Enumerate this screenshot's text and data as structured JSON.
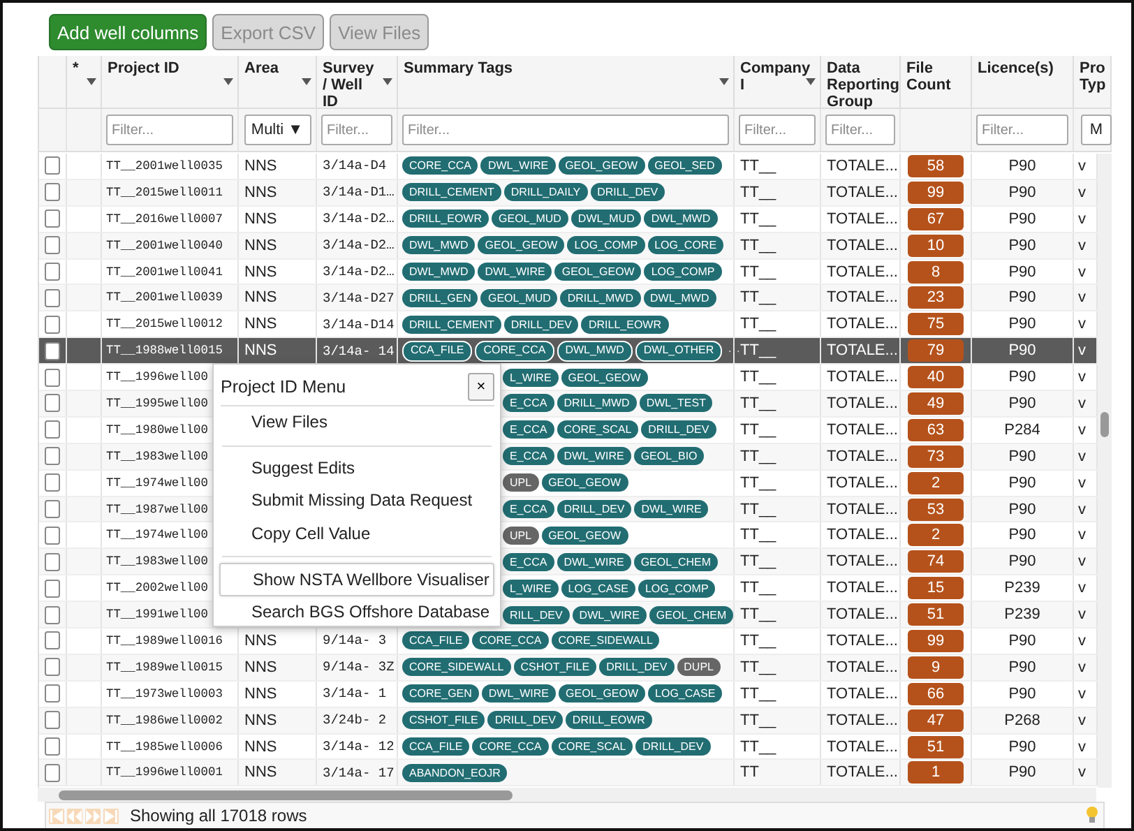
{
  "toolbar": {
    "buttons": [
      {
        "label": "Add well columns",
        "disabled": false
      },
      {
        "label": "Export CSV",
        "disabled": true
      },
      {
        "label": "View Files",
        "disabled": true
      }
    ]
  },
  "table": {
    "columns": [
      {
        "label": "*",
        "has_menu": true
      },
      {
        "label": "Project ID",
        "has_menu": true,
        "filter": {
          "kind": "text",
          "placeholder": "Filter..."
        }
      },
      {
        "label": "Area",
        "has_menu": true,
        "filter": {
          "kind": "select",
          "value": "Multi ▼"
        }
      },
      {
        "label": "Survey / Well ID",
        "has_menu": true,
        "filter": {
          "kind": "text",
          "placeholder": "Filter..."
        }
      },
      {
        "label": "Summary Tags",
        "has_menu": true,
        "filter": {
          "kind": "text",
          "placeholder": "Filter..."
        }
      },
      {
        "label": "Company I",
        "has_menu": true,
        "filter": {
          "kind": "text",
          "placeholder": "Filter..."
        }
      },
      {
        "label": "Data Reporting Group",
        "has_menu": false,
        "filter": {
          "kind": "text",
          "placeholder": "Filter..."
        }
      },
      {
        "label": "File Count",
        "has_menu": false
      },
      {
        "label": "Licence(s)",
        "has_menu": false,
        "filter": {
          "kind": "text",
          "placeholder": "Filter..."
        }
      },
      {
        "label": "Pro Typ",
        "has_menu": false,
        "filter": {
          "kind": "select",
          "value": "M"
        }
      }
    ],
    "rows": [
      {
        "checked": false,
        "selected": false,
        "covered": false,
        "project_id": "TT__2001well0035",
        "area": "NNS",
        "survey": "3/14a-D4",
        "tags": [
          {
            "label": "CORE_CCA",
            "kind": "tag"
          },
          {
            "label": "DWL_WIRE",
            "kind": "tag"
          },
          {
            "label": "GEOL_GEOW",
            "kind": "tag"
          },
          {
            "label": "GEOL_SED",
            "kind": "tag"
          }
        ],
        "company": "TT__",
        "group": "TOTALE...",
        "file_count": "58",
        "licence": "P90",
        "type": "v"
      },
      {
        "checked": false,
        "selected": false,
        "covered": false,
        "project_id": "TT__2015well0011",
        "area": "NNS",
        "survey": "3/14a-D1…",
        "tags": [
          {
            "label": "DRILL_CEMENT",
            "kind": "tag"
          },
          {
            "label": "DRILL_DAILY",
            "kind": "tag"
          },
          {
            "label": "DRILL_DEV",
            "kind": "tag"
          }
        ],
        "company": "TT__",
        "group": "TOTALE...",
        "file_count": "99",
        "licence": "P90",
        "type": "v"
      },
      {
        "checked": false,
        "selected": false,
        "covered": false,
        "project_id": "TT__2016well0007",
        "area": "NNS",
        "survey": "3/14a-D2…",
        "tags": [
          {
            "label": "DRILL_EOWR",
            "kind": "tag"
          },
          {
            "label": "GEOL_MUD",
            "kind": "tag"
          },
          {
            "label": "DWL_MUD",
            "kind": "tag"
          },
          {
            "label": "DWL_MWD",
            "kind": "tag"
          }
        ],
        "company": "TT__",
        "group": "TOTALE...",
        "file_count": "67",
        "licence": "P90",
        "type": "v"
      },
      {
        "checked": false,
        "selected": false,
        "covered": false,
        "project_id": "TT__2001well0040",
        "area": "NNS",
        "survey": "3/14a-D2…",
        "tags": [
          {
            "label": "DWL_MWD",
            "kind": "tag"
          },
          {
            "label": "GEOL_GEOW",
            "kind": "tag"
          },
          {
            "label": "LOG_COMP",
            "kind": "tag"
          },
          {
            "label": "LOG_CORE",
            "kind": "tag"
          }
        ],
        "company": "TT__",
        "group": "TOTALE...",
        "file_count": "10",
        "licence": "P90",
        "type": "v"
      },
      {
        "checked": false,
        "selected": false,
        "covered": false,
        "project_id": "TT__2001well0041",
        "area": "NNS",
        "survey": "3/14a-D2…",
        "tags": [
          {
            "label": "DWL_MWD",
            "kind": "tag"
          },
          {
            "label": "DWL_WIRE",
            "kind": "tag"
          },
          {
            "label": "GEOL_GEOW",
            "kind": "tag"
          },
          {
            "label": "LOG_COMP",
            "kind": "tag"
          }
        ],
        "company": "TT__",
        "group": "TOTALE...",
        "file_count": "8",
        "licence": "P90",
        "type": "v"
      },
      {
        "checked": false,
        "selected": false,
        "covered": false,
        "project_id": "TT__2001well0039",
        "area": "NNS",
        "survey": "3/14a-D27",
        "tags": [
          {
            "label": "DRILL_GEN",
            "kind": "tag"
          },
          {
            "label": "GEOL_MUD",
            "kind": "tag"
          },
          {
            "label": "DRILL_MWD",
            "kind": "tag"
          },
          {
            "label": "DWL_MWD",
            "kind": "tag"
          }
        ],
        "company": "TT__",
        "group": "TOTALE...",
        "file_count": "23",
        "licence": "P90",
        "type": "v"
      },
      {
        "checked": false,
        "selected": false,
        "covered": false,
        "project_id": "TT__2015well0012",
        "area": "NNS",
        "survey": "3/14a-D14",
        "tags": [
          {
            "label": "DRILL_CEMENT",
            "kind": "tag"
          },
          {
            "label": "DRILL_DEV",
            "kind": "tag"
          },
          {
            "label": "DRILL_EOWR",
            "kind": "tag"
          }
        ],
        "company": "TT__",
        "group": "TOTALE...",
        "file_count": "75",
        "licence": "P90",
        "type": "v"
      },
      {
        "checked": false,
        "selected": true,
        "covered": false,
        "project_id": "TT__1988well0015",
        "area": "NNS",
        "survey": "3/14a- 14",
        "tags": [
          {
            "label": "CCA_FILE",
            "kind": "tag"
          },
          {
            "label": "CORE_CCA",
            "kind": "tag"
          },
          {
            "label": "DWL_MWD",
            "kind": "tag"
          },
          {
            "label": "DWL_OTHER",
            "kind": "tag"
          }
        ],
        "more": "···",
        "company": "TT__",
        "group": "TOTALE...",
        "file_count": "79",
        "licence": "P90",
        "type": "v"
      },
      {
        "checked": false,
        "selected": false,
        "covered": true,
        "project_id": "TT__1996well00",
        "tags": [
          {
            "label": "L_WIRE",
            "kind": "tag"
          },
          {
            "label": "GEOL_GEOW",
            "kind": "tag"
          }
        ],
        "company": "TT__",
        "group": "TOTALE...",
        "file_count": "40",
        "licence": "P90",
        "type": "v"
      },
      {
        "checked": false,
        "selected": false,
        "covered": true,
        "project_id": "TT__1995well00",
        "tags": [
          {
            "label": "E_CCA",
            "kind": "tag"
          },
          {
            "label": "DRILL_MWD",
            "kind": "tag"
          },
          {
            "label": "DWL_TEST",
            "kind": "tag"
          }
        ],
        "company": "TT__",
        "group": "TOTALE...",
        "file_count": "49",
        "licence": "P90",
        "type": "v"
      },
      {
        "checked": false,
        "selected": false,
        "covered": true,
        "project_id": "TT__1980well00",
        "tags": [
          {
            "label": "E_CCA",
            "kind": "tag"
          },
          {
            "label": "CORE_SCAL",
            "kind": "tag"
          },
          {
            "label": "DRILL_DEV",
            "kind": "tag"
          }
        ],
        "company": "TT__",
        "group": "TOTALE...",
        "file_count": "63",
        "licence": "P284",
        "type": "v"
      },
      {
        "checked": false,
        "selected": false,
        "covered": true,
        "project_id": "TT__1983well00",
        "tags": [
          {
            "label": "E_CCA",
            "kind": "tag"
          },
          {
            "label": "DWL_WIRE",
            "kind": "tag"
          },
          {
            "label": "GEOL_BIO",
            "kind": "tag"
          }
        ],
        "company": "TT__",
        "group": "TOTALE...",
        "file_count": "73",
        "licence": "P90",
        "type": "v"
      },
      {
        "checked": false,
        "selected": false,
        "covered": true,
        "project_id": "TT__1974well00",
        "tags": [
          {
            "label": "UPL",
            "kind": "flag"
          },
          {
            "label": "GEOL_GEOW",
            "kind": "tag"
          }
        ],
        "company": "TT__",
        "group": "TOTALE...",
        "file_count": "2",
        "licence": "P90",
        "type": "v"
      },
      {
        "checked": false,
        "selected": false,
        "covered": true,
        "project_id": "TT__1987well00",
        "tags": [
          {
            "label": "E_CCA",
            "kind": "tag"
          },
          {
            "label": "DRILL_DEV",
            "kind": "tag"
          },
          {
            "label": "DWL_WIRE",
            "kind": "tag"
          }
        ],
        "company": "TT__",
        "group": "TOTALE...",
        "file_count": "53",
        "licence": "P90",
        "type": "v"
      },
      {
        "checked": false,
        "selected": false,
        "covered": true,
        "project_id": "TT__1974well00",
        "tags": [
          {
            "label": "UPL",
            "kind": "flag"
          },
          {
            "label": "GEOL_GEOW",
            "kind": "tag"
          }
        ],
        "company": "TT__",
        "group": "TOTALE...",
        "file_count": "2",
        "licence": "P90",
        "type": "v"
      },
      {
        "checked": false,
        "selected": false,
        "covered": true,
        "project_id": "TT__1983well00",
        "tags": [
          {
            "label": "E_CCA",
            "kind": "tag"
          },
          {
            "label": "DWL_WIRE",
            "kind": "tag"
          },
          {
            "label": "GEOL_CHEM",
            "kind": "tag"
          }
        ],
        "company": "TT__",
        "group": "TOTALE...",
        "file_count": "74",
        "licence": "P90",
        "type": "v"
      },
      {
        "checked": false,
        "selected": false,
        "covered": true,
        "project_id": "TT__2002well00",
        "tags": [
          {
            "label": "L_WIRE",
            "kind": "tag"
          },
          {
            "label": "LOG_CASE",
            "kind": "tag"
          },
          {
            "label": "LOG_COMP",
            "kind": "tag"
          }
        ],
        "company": "TT__",
        "group": "TOTALE...",
        "file_count": "15",
        "licence": "P239",
        "type": "v"
      },
      {
        "checked": false,
        "selected": false,
        "covered": true,
        "project_id": "TT__1991well00",
        "tags": [
          {
            "label": "RILL_DEV",
            "kind": "tag"
          },
          {
            "label": "DWL_WIRE",
            "kind": "tag"
          },
          {
            "label": "GEOL_CHEM",
            "kind": "tag"
          }
        ],
        "company": "TT__",
        "group": "TOTALE...",
        "file_count": "51",
        "licence": "P239",
        "type": "v"
      },
      {
        "checked": false,
        "selected": false,
        "covered": false,
        "project_id": "TT__1989well0016",
        "area": "NNS",
        "survey": "9/14a- 3",
        "tags": [
          {
            "label": "CCA_FILE",
            "kind": "tag"
          },
          {
            "label": "CORE_CCA",
            "kind": "tag"
          },
          {
            "label": "CORE_SIDEWALL",
            "kind": "tag"
          }
        ],
        "company": "TT__",
        "group": "TOTALE...",
        "file_count": "99",
        "licence": "P90",
        "type": "v"
      },
      {
        "checked": false,
        "selected": false,
        "covered": false,
        "project_id": "TT__1989well0015",
        "area": "NNS",
        "survey": "9/14a- 3Z",
        "tags": [
          {
            "label": "CORE_SIDEWALL",
            "kind": "tag"
          },
          {
            "label": "CSHOT_FILE",
            "kind": "tag"
          },
          {
            "label": "DRILL_DEV",
            "kind": "tag"
          },
          {
            "label": "DUPL",
            "kind": "flag"
          }
        ],
        "company": "TT__",
        "group": "TOTALE...",
        "file_count": "9",
        "licence": "P90",
        "type": "v"
      },
      {
        "checked": false,
        "selected": false,
        "covered": false,
        "project_id": "TT__1973well0003",
        "area": "NNS",
        "survey": "3/14a- 1",
        "tags": [
          {
            "label": "CORE_GEN",
            "kind": "tag"
          },
          {
            "label": "DWL_WIRE",
            "kind": "tag"
          },
          {
            "label": "GEOL_GEOW",
            "kind": "tag"
          },
          {
            "label": "LOG_CASE",
            "kind": "tag"
          }
        ],
        "company": "TT__",
        "group": "TOTALE...",
        "file_count": "66",
        "licence": "P90",
        "type": "v"
      },
      {
        "checked": false,
        "selected": false,
        "covered": false,
        "project_id": "TT__1986well0002",
        "area": "NNS",
        "survey": "3/24b- 2",
        "tags": [
          {
            "label": "CSHOT_FILE",
            "kind": "tag"
          },
          {
            "label": "DRILL_DEV",
            "kind": "tag"
          },
          {
            "label": "DRILL_EOWR",
            "kind": "tag"
          }
        ],
        "company": "TT__",
        "group": "TOTALE...",
        "file_count": "47",
        "licence": "P268",
        "type": "v"
      },
      {
        "checked": false,
        "selected": false,
        "covered": false,
        "project_id": "TT__1985well0006",
        "area": "NNS",
        "survey": "3/14a- 12",
        "tags": [
          {
            "label": "CCA_FILE",
            "kind": "tag"
          },
          {
            "label": "CORE_CCA",
            "kind": "tag"
          },
          {
            "label": "CORE_SCAL",
            "kind": "tag"
          },
          {
            "label": "DRILL_DEV",
            "kind": "tag"
          }
        ],
        "company": "TT__",
        "group": "TOTALE...",
        "file_count": "51",
        "licence": "P90",
        "type": "v"
      },
      {
        "checked": false,
        "selected": false,
        "covered": false,
        "project_id": "TT__1996well0001",
        "area": "NNS",
        "survey": "3/14a- 17",
        "tags": [
          {
            "label": "ABANDON_EOJR",
            "kind": "tag"
          }
        ],
        "company": "TT",
        "group": "TOTALE...",
        "file_count": "1",
        "licence": "P90",
        "type": "v"
      }
    ]
  },
  "context_menu": {
    "title": "Project ID Menu",
    "close": "×",
    "items": [
      {
        "kind": "item",
        "label": "View Files",
        "selected": false
      },
      {
        "kind": "separator"
      },
      {
        "kind": "item",
        "label": "Suggest Edits",
        "selected": false
      },
      {
        "kind": "item",
        "label": "Submit Missing Data Request",
        "selected": false
      },
      {
        "kind": "item",
        "label": "Copy Cell Value",
        "selected": false
      },
      {
        "kind": "separator"
      },
      {
        "kind": "item",
        "label": "Show NSTA Wellbore Visualiser",
        "selected": true
      },
      {
        "kind": "item",
        "label": "Search BGS Offshore Database",
        "selected": false
      }
    ]
  },
  "status_bar": {
    "text": "Showing all 17018 rows"
  }
}
